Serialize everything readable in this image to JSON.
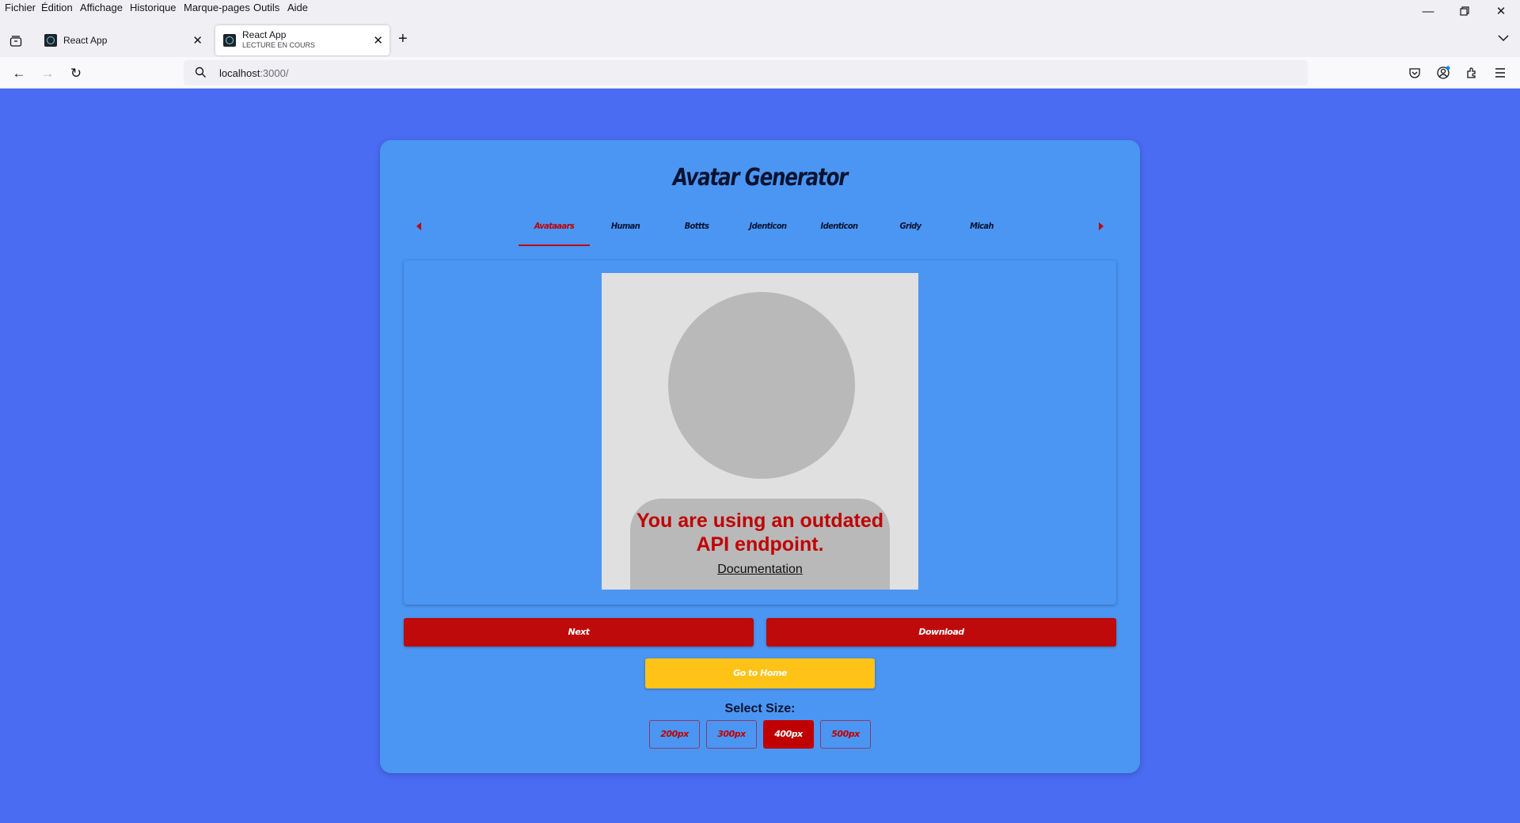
{
  "browser": {
    "menu": [
      "Fichier",
      "Édition",
      "Affichage",
      "Historique",
      "Marque-pages",
      "Outils",
      "Aide"
    ],
    "tabs": [
      {
        "title": "React App",
        "subtitle": ""
      },
      {
        "title": "React App",
        "subtitle": "LECTURE EN COURS"
      }
    ],
    "url_host": "localhost",
    "url_rest": ":3000/"
  },
  "page": {
    "title": "Avatar Generator",
    "categories": [
      "Avataaars",
      "Human",
      "Bottts",
      "Jdenticon",
      "Identicon",
      "Gridy",
      "Micah"
    ],
    "active_category": "Avataaars",
    "preview": {
      "message": "You are using an outdated API endpoint.",
      "link": "Documentation"
    },
    "buttons": {
      "next": "Next",
      "download": "Download",
      "home": "Go to Home"
    },
    "size": {
      "label": "Select Size:",
      "options": [
        "200px",
        "300px",
        "400px",
        "500px"
      ],
      "selected": "400px"
    }
  },
  "colors": {
    "page_bg": "#4a6cf3",
    "card_bg": "#4b96f3",
    "accent_red": "#c00000",
    "accent_yellow": "#ffc317"
  }
}
